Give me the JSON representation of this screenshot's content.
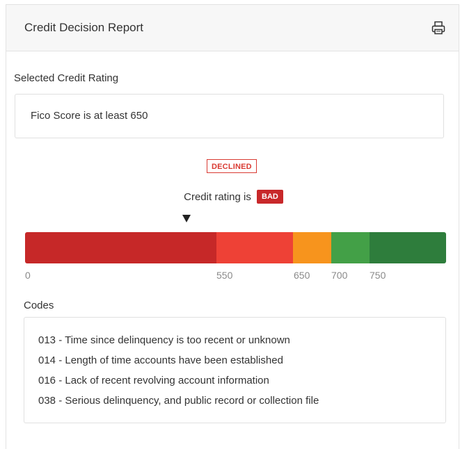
{
  "header": {
    "title": "Credit Decision Report",
    "print_icon": "printer-icon"
  },
  "selected_rating": {
    "label": "Selected Credit Rating",
    "value": "Fico Score is at least 650"
  },
  "decision": {
    "status": "DECLINED",
    "status_color": "#d93a32",
    "rating_prefix": "Credit rating is",
    "rating": "BAD",
    "rating_color": "#c8282a"
  },
  "scale": {
    "segments": [
      {
        "color": "#c62828"
      },
      {
        "color": "#ee4136"
      },
      {
        "color": "#f7941d"
      },
      {
        "color": "#43a047"
      },
      {
        "color": "#2e7d3c"
      }
    ],
    "ticks": [
      "0",
      "550",
      "650",
      "700",
      "750"
    ]
  },
  "codes": {
    "label": "Codes",
    "items": [
      "013 - Time since delinquency is too recent or unknown",
      "014 - Length of time accounts have been established",
      "016 - Lack of recent revolving account information",
      "038 - Serious delinquency, and public record or collection file"
    ]
  }
}
